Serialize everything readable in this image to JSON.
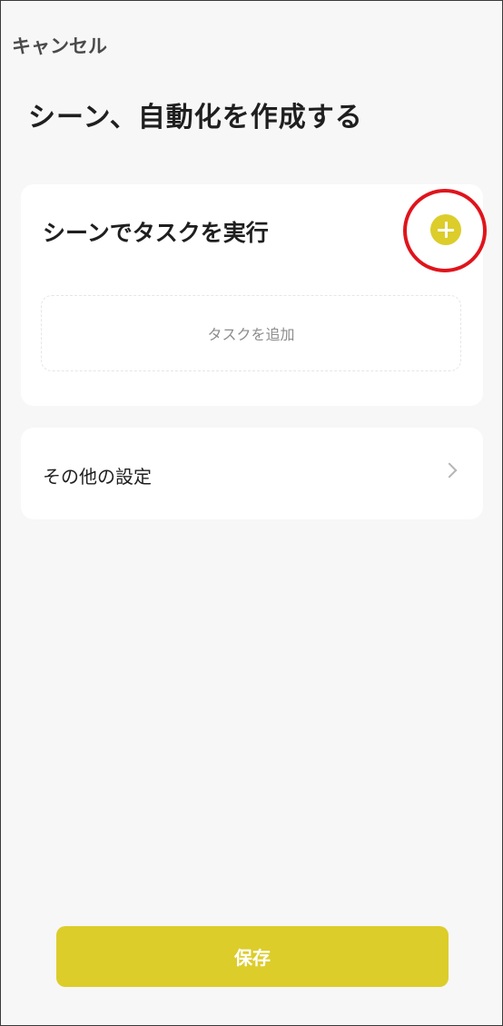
{
  "header": {
    "cancel_label": "キャンセル",
    "title": "シーン、自動化を作成する"
  },
  "task_card": {
    "title": "シーンでタスクを実行",
    "add_icon": "plus-circle-icon",
    "add_task_label": "タスクを追加"
  },
  "settings_card": {
    "label": "その他の設定",
    "arrow_icon": "chevron-right-icon"
  },
  "footer": {
    "save_label": "保存"
  },
  "colors": {
    "accent": "#dccd2b",
    "highlight": "#e0141c",
    "background": "#f7f7f7",
    "card": "#ffffff",
    "title_text": "#1f1f1f"
  }
}
